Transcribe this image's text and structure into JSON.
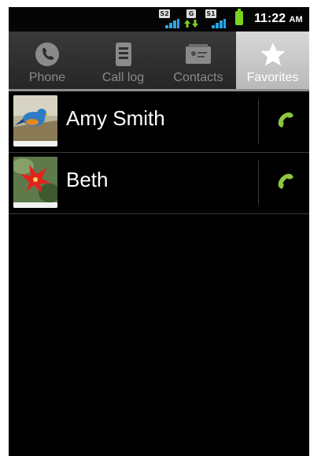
{
  "status_bar": {
    "sim1_label": "S2",
    "sim2_label": "S1",
    "data_badge": "G",
    "time": "11:22",
    "ampm": "AM",
    "signal_color": "#2aa4e4",
    "battery_color": "#7bd21d"
  },
  "tabs": [
    {
      "label": "Phone",
      "icon": "phone-icon",
      "active": false
    },
    {
      "label": "Call log",
      "icon": "call-log-icon",
      "active": false
    },
    {
      "label": "Contacts",
      "icon": "contacts-icon",
      "active": false
    },
    {
      "label": "Favorites",
      "icon": "star-icon",
      "active": true
    }
  ],
  "favorites": [
    {
      "name": "Amy Smith",
      "photo": "bird-photo",
      "action_icon": "call-icon"
    },
    {
      "name": "Beth",
      "photo": "flower-photo",
      "action_icon": "call-icon"
    }
  ],
  "colors": {
    "background": "#000000",
    "call_icon": "#8dc63f",
    "active_tab": "#c8c8c8"
  }
}
